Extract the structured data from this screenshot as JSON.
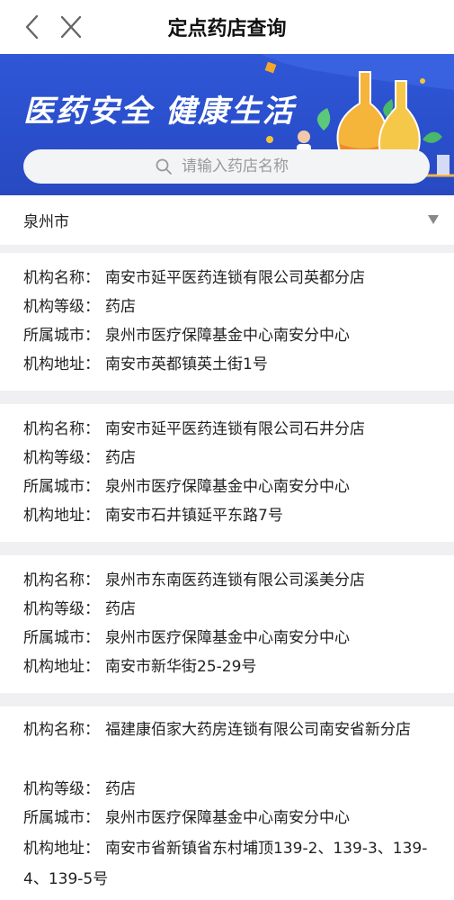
{
  "header": {
    "title": "定点药店查询"
  },
  "banner": {
    "slogan": "医药安全 健康生活"
  },
  "search": {
    "placeholder": "请输入药店名称",
    "value": ""
  },
  "city": {
    "selected": "泉州市"
  },
  "labels": {
    "name": "机构名称：",
    "level": "机构等级：",
    "city": "所属城市：",
    "address": "机构地址："
  },
  "pharmacies": [
    {
      "name": "南安市延平医药连锁有限公司英都分店",
      "level": "药店",
      "city": "泉州市医疗保障基金中心南安分中心",
      "address": "南安市英都镇英土街1号"
    },
    {
      "name": "南安市延平医药连锁有限公司石井分店",
      "level": "药店",
      "city": "泉州市医疗保障基金中心南安分中心",
      "address": "南安市石井镇延平东路7号"
    },
    {
      "name": "泉州市东南医药连锁有限公司溪美分店",
      "level": "药店",
      "city": "泉州市医疗保障基金中心南安分中心",
      "address": "南安市新华街25-29号"
    },
    {
      "name": "福建康佰家大药房连锁有限公司南安省新分店",
      "level": "药店",
      "city": "泉州市医疗保障基金中心南安分中心",
      "address": "南安市省新镇省东村埔顶139-2、139-3、139-4、139-5号"
    }
  ],
  "colors": {
    "banner_blue": "#2a4fcc",
    "divider": "#f0f0f2"
  }
}
